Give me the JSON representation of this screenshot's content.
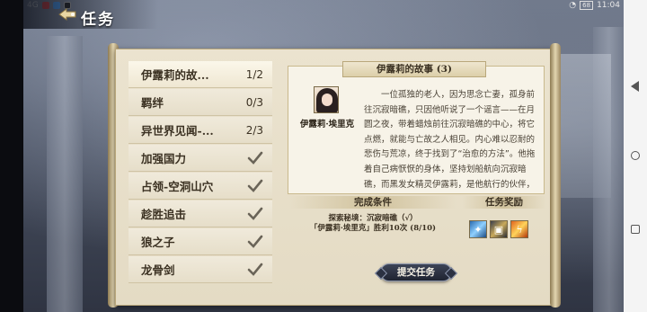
{
  "status_bar": {
    "left_text": "4G",
    "time": "11:04",
    "battery": "68"
  },
  "header": {
    "title": "任务"
  },
  "quest_list": [
    {
      "name": "伊露莉的故...",
      "progress": "1/2",
      "completed": false,
      "selected": true
    },
    {
      "name": "羁绊",
      "progress": "0/3",
      "completed": false,
      "selected": false
    },
    {
      "name": "异世界见闻-...",
      "progress": "2/3",
      "completed": false,
      "selected": false
    },
    {
      "name": "加强国力",
      "progress": "",
      "completed": true,
      "selected": false
    },
    {
      "name": "占领-空洞山穴",
      "progress": "",
      "completed": true,
      "selected": false
    },
    {
      "name": "趁胜追击",
      "progress": "",
      "completed": true,
      "selected": false
    },
    {
      "name": "狼之子",
      "progress": "",
      "completed": true,
      "selected": false
    },
    {
      "name": "龙骨剑",
      "progress": "",
      "completed": true,
      "selected": false
    }
  ],
  "story": {
    "title": "伊露莉的故事 (3)",
    "character_name": "伊露莉·埃里克",
    "text": "一位孤独的老人，因为思念亡妻，孤身前往沉寂暗礁，只因他听说了一个谣言——在月圆之夜，带着蜡烛前往沉寂暗礁的中心，将它点燃，就能与亡故之人相见。内心难以忍耐的悲伤与荒凉，终于找到了“治愈的方法”。他拖着自己病恹恹的身体，坚持划船航向沉寂暗礁，而黑发女精灵伊露莉，是他航行的伙伴，告诉他这不是传说，也"
  },
  "conditions": {
    "header": "完成条件",
    "line1": "探索秘境：沉寂暗礁（√）",
    "line2": "「伊露莉·埃里克」胜利10次 (8/10)"
  },
  "rewards": {
    "header": "任务奖励",
    "items": [
      "blue-crystal-icon",
      "mechanism-box-icon",
      "lightning-scroll-icon"
    ]
  },
  "submit_label": "提交任务"
}
